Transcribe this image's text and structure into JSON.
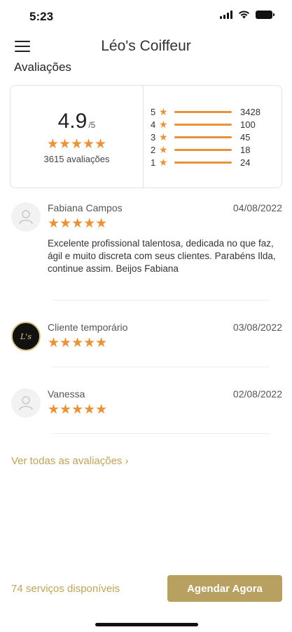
{
  "status_bar": {
    "time": "5:23"
  },
  "header": {
    "title": "Léo's Coiffeur",
    "menu_icon": "hamburger-menu-icon"
  },
  "section": {
    "title": "Avaliações"
  },
  "summary": {
    "score": "4.9",
    "score_max": "/5",
    "stars": "★★★★★",
    "total_label": "3615 avaliações",
    "breakdown": [
      {
        "stars": "5",
        "count": "3428"
      },
      {
        "stars": "4",
        "count": "100"
      },
      {
        "stars": "3",
        "count": "45"
      },
      {
        "stars": "2",
        "count": "18"
      },
      {
        "stars": "1",
        "count": "24"
      }
    ],
    "star_color": "#e8923a"
  },
  "reviews": [
    {
      "name": "Fabiana Campos",
      "date": "04/08/2022",
      "stars": "★★★★★",
      "text": "Excelente profissional talentosa, dedicada no que faz, ágil e muito discreta com seus clientes. Parabéns Ilda, continue assim. Beijos Fabiana",
      "avatar": "user-placeholder-icon"
    },
    {
      "name": "Cliente temporário",
      "date": "03/08/2022",
      "stars": "★★★★★",
      "text": "",
      "avatar": "salon-logo"
    },
    {
      "name": "Vanessa",
      "date": "02/08/2022",
      "stars": "★★★★★",
      "text": "",
      "avatar": "user-placeholder-icon"
    }
  ],
  "see_all": {
    "label": "Ver todas as avaliações",
    "icon": "chevron-right-icon"
  },
  "footer": {
    "services_label": "74 serviços disponíveis",
    "book_button": "Agendar Agora",
    "accent_color": "#b7a060"
  }
}
